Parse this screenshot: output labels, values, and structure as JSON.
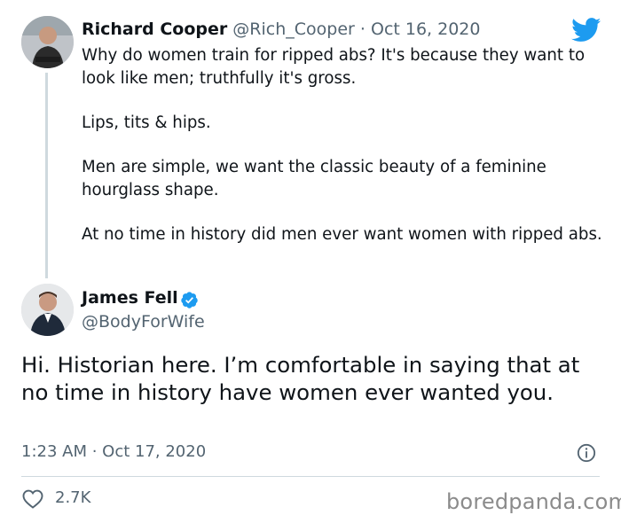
{
  "reply_tweet": {
    "author_name": "Richard Cooper",
    "author_handle": "@Rich_Cooper",
    "separator": "·",
    "date": "Oct 16, 2020",
    "paragraphs": [
      "Why do women train for ripped abs?  It's because they want to look like men; truthfully it's gross.",
      "Lips, tits & hips.",
      "Men are simple, we want the classic beauty of a feminine hourglass shape.",
      "At no time in history did men ever want women with ripped abs."
    ]
  },
  "main_tweet": {
    "author_name": "James Fell",
    "author_handle": "@BodyForWife",
    "text": "Hi. Historian here. I’m comfortable in saying that at no time in history have women ever wanted you.",
    "timestamp": "1:23 AM · Oct 17, 2020",
    "like_count": "2.7K"
  },
  "icons": {
    "platform": "twitter-bird-icon",
    "verified": "verified-badge-icon",
    "info": "info-icon",
    "like": "heart-icon"
  },
  "colors": {
    "twitter_blue": "#1d9bf0",
    "text": "#0f1419",
    "muted": "#536471",
    "divider": "#cfd9de",
    "watermark": "#8b8b8b"
  },
  "watermark": "boredpanda.com"
}
